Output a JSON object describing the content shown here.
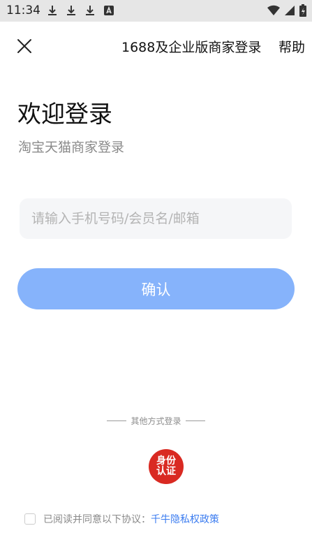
{
  "status_bar": {
    "time": "11:34"
  },
  "header": {
    "merchant_login_link": "1688及企业版商家登录",
    "help_link": "帮助"
  },
  "welcome": {
    "title": "欢迎登录",
    "subtitle": "淘宝天猫商家登录"
  },
  "form": {
    "account_placeholder": "请输入手机号码/会员名/邮箱",
    "account_value": "",
    "confirm_label": "确认"
  },
  "other_login": {
    "label": "其他方式登录",
    "identity_auth_line1": "身份",
    "identity_auth_line2": "认证"
  },
  "agreement": {
    "text": "已阅读并同意以下协议：",
    "policy_link": "千牛隐私权政策",
    "checked": false
  },
  "colors": {
    "accent": "#86b3fb",
    "link": "#3b7cf0",
    "identity_badge": "#d92a22"
  }
}
